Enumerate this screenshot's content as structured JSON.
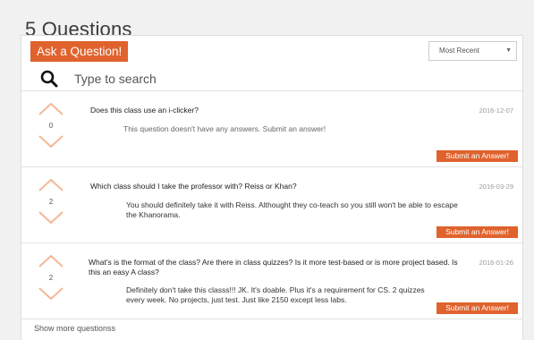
{
  "page": {
    "title": "5 Questions"
  },
  "toolbar": {
    "ask_label": "Ask a Question!",
    "sort_selected": "Most Recent"
  },
  "search": {
    "placeholder": "Type to search"
  },
  "questions": [
    {
      "votes": "0",
      "title": "Does this class use an i-clicker?",
      "date": "2016-12-07",
      "answer": "This question doesn't have any answers. Submit an answer!",
      "submit_label": "Submit an Answer!"
    },
    {
      "votes": "2",
      "title": "Which class should I take the professor with? Reiss or Khan?",
      "date": "2016-03-29",
      "answer": "You should definitely take it with Reiss. Althought they co-teach so you still won't be able to escape the Khanorama.",
      "submit_label": "Submit an Answer!"
    },
    {
      "votes": "2",
      "title": "What's is the format of the class? Are there in class quizzes? Is it more test-based or is more project based. Is this an easy A class?",
      "date": "2016-01-26",
      "answer": "Definitely don't take this classs!!! JK. It's doable. Plus it's a requirement for CS. 2 quizzes every week. No projects, just test. Just like 2150 except less labs.",
      "submit_label": "Submit an Answer!"
    }
  ],
  "footer": {
    "show_more": "Show more questionss"
  },
  "colors": {
    "accent": "#e0622d",
    "vote_arrow": "#f4b896"
  }
}
